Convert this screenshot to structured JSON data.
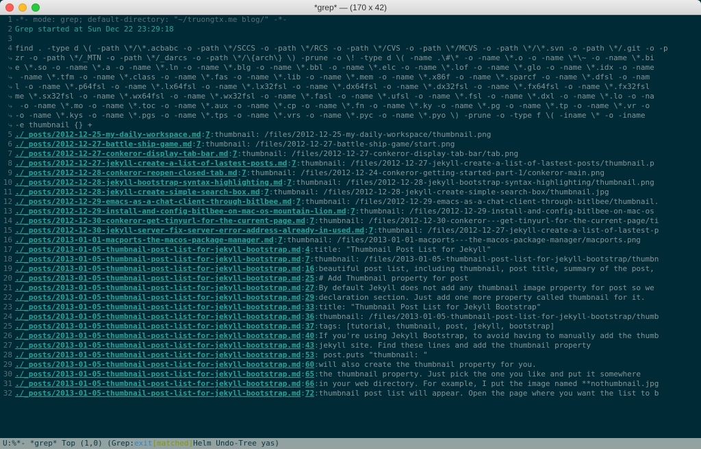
{
  "window": {
    "title": "*grep*  —  (170 x 42)"
  },
  "header": {
    "l1_num": "1",
    "l1": "-*- mode: grep; default-directory: \"~/truongtx.me blog/\" -*-",
    "l2_num": "2",
    "l2": "Grep started at Sun Dec 22 23:29:18",
    "l3_num": "3",
    "l4_num": "4",
    "find_lines": [
      "find . -type d \\( -path \\*/\\*.acbabc -o -path \\*/SCCS -o -path \\*/RCS -o -path \\*/CVS -o -path \\*/MCVS -o -path \\*/\\*.svn -o -path \\*/.git -o -p",
      "zr -o -path \\*/_MTN -o -path \\*/_darcs -o -path \\*/\\{arch\\} \\) -prune -o \\! -type d \\( -name .\\#\\* -o -name \\*.o -o -name \\*\\~ -o -name \\*.bi",
      "e \\*.so -o -name \\*.a -o -name \\*.ln -o -name \\*.blg -o -name \\*.bbl -o -name \\*.elc -o -name \\*.lof -o -name \\*.glo -o -name \\*.idx -o -name",
      " -name \\*.tfm -o -name \\*.class -o -name \\*.fas -o -name \\*.lib -o -name \\*.mem -o -name \\*.x86f -o -name \\*.sparcf -o -name \\*.dfsl -o -nam",
      "l -o -name \\*.p64fsl -o -name \\*.lx64fsl -o -name \\*.lx32fsl -o -name \\*.dx64fsl -o -name \\*.dx32fsl -o -name \\*.fx64fsl -o -name \\*.fx32fsl",
      "me \\*.sx32fsl -o -name \\*.wx64fsl -o -name \\*.wx32fsl -o -name \\*.fasl -o -name \\*.ufsl -o -name \\*.fsl -o -name \\*.dxl -o -name \\*.lo -o -na",
      " -o -name \\*.mo -o -name \\*.toc -o -name \\*.aux -o -name \\*.cp -o -name \\*.fn -o -name \\*.ky -o -name \\*.pg -o -name \\*.tp -o -name \\*.vr -o ",
      "-o -name \\*.kys -o -name \\*.pgs -o -name \\*.tps -o -name \\*.vrs -o -name \\*.pyc -o -name \\*.pyo \\) -prune -o  -type f \\( -iname \\* -o -iname",
      "-e thumbnail {} +"
    ]
  },
  "results": [
    {
      "num": "5",
      "file": "./_posts/2012-12-25-my-daily-workspace.md",
      "line": "7",
      "col": "",
      "rest": "thumbnail: /files/2012-12-25-my-daily-workspace/thumbnail.png"
    },
    {
      "num": "6",
      "file": "./_posts/2012-12-27-battle-ship-game.md",
      "line": "7",
      "col": "",
      "rest": "thumbnail: /files/2012-12-27-battle-ship-game/start.png"
    },
    {
      "num": "7",
      "file": "./_posts/2012-12-27-conkeror-display-tab-bar.md",
      "line": "7",
      "col": "",
      "rest": "thumbnail: /files/2012-12-27-conkeror-display-tab-bar/tab.png"
    },
    {
      "num": "8",
      "file": "./_posts/2012-12-27-jekyll-create-a-list-of-lastest-posts.md",
      "line": "7",
      "col": "",
      "rest": "thumbnail: /files/2012-12-27-jekyll-create-a-list-of-lastest-posts/thumbnail.p"
    },
    {
      "num": "9",
      "file": "./_posts/2012-12-28-conkeror-reopen-closed-tab.md",
      "line": "7",
      "col": "",
      "rest": "thumbnail: /files/2012-12-24-conkeror-getting-started-part-1/conkeror-main.png"
    },
    {
      "num": "10",
      "file": "./_posts/2012-12-28-jekyll-bootstrap-syntax-highlighting.md",
      "line": "7",
      "col": "",
      "rest": "thumbnail: /files/2012-12-28-jekyll-bootstrap-syntax-highlighting/thumbnail.png"
    },
    {
      "num": "11",
      "file": "./_posts/2012-12-28-jekyll-create-simple-search-box.md",
      "line": "7",
      "col": "",
      "rest": "thumbnail: /files/2012-12-28-jekyll-create-simple-search-box/thumbnail.jpg"
    },
    {
      "num": "12",
      "file": "./_posts/2012-12-29-emacs-as-a-chat-client-through-bitlbee.md",
      "line": "7",
      "col": "",
      "rest": "thumbnail: /files/2012-12-29-emacs-as-a-chat-client-through-bitlbee/thumbnail."
    },
    {
      "num": "13",
      "file": "./_posts/2012-12-29-install-and-config-bitlbee-on-mac-os-mountain-lion.md",
      "line": "7",
      "col": "",
      "rest": "thumbnail: /files/2012-12-29-install-and-config-bitlbee-on-mac-os"
    },
    {
      "num": "14",
      "file": "./_posts/2012-12-30-conkeror-get-tinyurl-for-the-current-page.md",
      "line": "7",
      "col": "",
      "rest": "thumbnail: /files/2012-12-30-conkeror---get-tinyurl-for-the-current-page/ti"
    },
    {
      "num": "15",
      "file": "./_posts/2012-12-30-jekyll-server-fix-server-error-address-already-in-used.md",
      "line": "7",
      "col": "",
      "rest": "thumbnail: /files/2012-12-27-jekyll-create-a-list-of-lastest-p"
    },
    {
      "num": "16",
      "file": "./_posts/2013-01-01-macports-the-macos-package-manager.md",
      "line": "7",
      "col": "",
      "rest": "thumbnail: /files/2013-01-01-macports---the-macos-package-manager/macports.png"
    },
    {
      "num": "17",
      "file": "./_posts/2013-01-05-thumbnail-post-list-for-jekyll-bootstrap.md",
      "line": "4",
      "col": "",
      "rest": "title: \"Thumbnail Post List for Jekyll\""
    },
    {
      "num": "18",
      "file": "./_posts/2013-01-05-thumbnail-post-list-for-jekyll-bootstrap.md",
      "line": "7",
      "col": "",
      "rest": "thumbnail: /files/2013-01-05-thumbnail-post-list-for-jekyll-bootstrap/thumbn"
    },
    {
      "num": "19",
      "file": "./_posts/2013-01-05-thumbnail-post-list-for-jekyll-bootstrap.md",
      "line": "16",
      "col": "",
      "rest": "beautiful post list, including thumbnail, post title, summary of the post, "
    },
    {
      "num": "20",
      "file": "./_posts/2013-01-05-thumbnail-post-list-for-jekyll-bootstrap.md",
      "line": "25",
      "col": "",
      "rest": "# Add Thumbnail property for post"
    },
    {
      "num": "21",
      "file": "./_posts/2013-01-05-thumbnail-post-list-for-jekyll-bootstrap.md",
      "line": "27",
      "col": "",
      "rest": "By default Jekyll does not add any thumbnail image property for post so we "
    },
    {
      "num": "22",
      "file": "./_posts/2013-01-05-thumbnail-post-list-for-jekyll-bootstrap.md",
      "line": "29",
      "col": "",
      "rest": "declaration section. Just add one more property called thumbnail for it."
    },
    {
      "num": "23",
      "file": "./_posts/2013-01-05-thumbnail-post-list-for-jekyll-bootstrap.md",
      "line": "33",
      "col": "",
      "rest": "title: \"Thumbnail Post List for Jekyll Bootstrap\""
    },
    {
      "num": "24",
      "file": "./_posts/2013-01-05-thumbnail-post-list-for-jekyll-bootstrap.md",
      "line": "36",
      "col": "",
      "rest": "thumbnail: /files/2013-01-05-thumbnail-post-list-for-jekyll-bootstrap/thumb"
    },
    {
      "num": "25",
      "file": "./_posts/2013-01-05-thumbnail-post-list-for-jekyll-bootstrap.md",
      "line": "37",
      "col": "",
      "rest": "tags: [tutorial, thumbnail, post, jekyll, bootstrap]"
    },
    {
      "num": "26",
      "file": "./_posts/2013-01-05-thumbnail-post-list-for-jekyll-bootstrap.md",
      "line": "40",
      "col": "",
      "rest": "If you're using Jekyll Bootstrap, to avoid having to manually add the thumb"
    },
    {
      "num": "27",
      "file": "./_posts/2013-01-05-thumbnail-post-list-for-jekyll-bootstrap.md",
      "line": "43",
      "col": "",
      "rest": "jekyll site. Find these lines and add the thumbnail property"
    },
    {
      "num": "28",
      "file": "./_posts/2013-01-05-thumbnail-post-list-for-jekyll-bootstrap.md",
      "line": "53",
      "col": "",
      "rest": "  post.puts \"thumbnail: \""
    },
    {
      "num": "29",
      "file": "./_posts/2013-01-05-thumbnail-post-list-for-jekyll-bootstrap.md",
      "line": "60",
      "col": "",
      "rest": "will also create the thumbnail property for you."
    },
    {
      "num": "30",
      "file": "./_posts/2013-01-05-thumbnail-post-list-for-jekyll-bootstrap.md",
      "line": "65",
      "col": "",
      "rest": "the thumbnail property. Just pick the one you like and put it somewhere"
    },
    {
      "num": "31",
      "file": "./_posts/2013-01-05-thumbnail-post-list-for-jekyll-bootstrap.md",
      "line": "66",
      "col": "",
      "rest": "in your web directory. For example, I put the image named **nothumbnail.jpg"
    },
    {
      "num": "32",
      "file": "./_posts/2013-01-05-thumbnail-post-list-for-jekyll-bootstrap.md",
      "line": "72",
      "col": "",
      "rest": "thumbnail post list will appear. Open the page where you want the list to b"
    }
  ],
  "modeline": {
    "left": "U:%*-  *grep*       Top (1,0)      (Grep:",
    "exit": "exit",
    "matched": " [matched]",
    "right": " Helm Undo-Tree yas)"
  }
}
